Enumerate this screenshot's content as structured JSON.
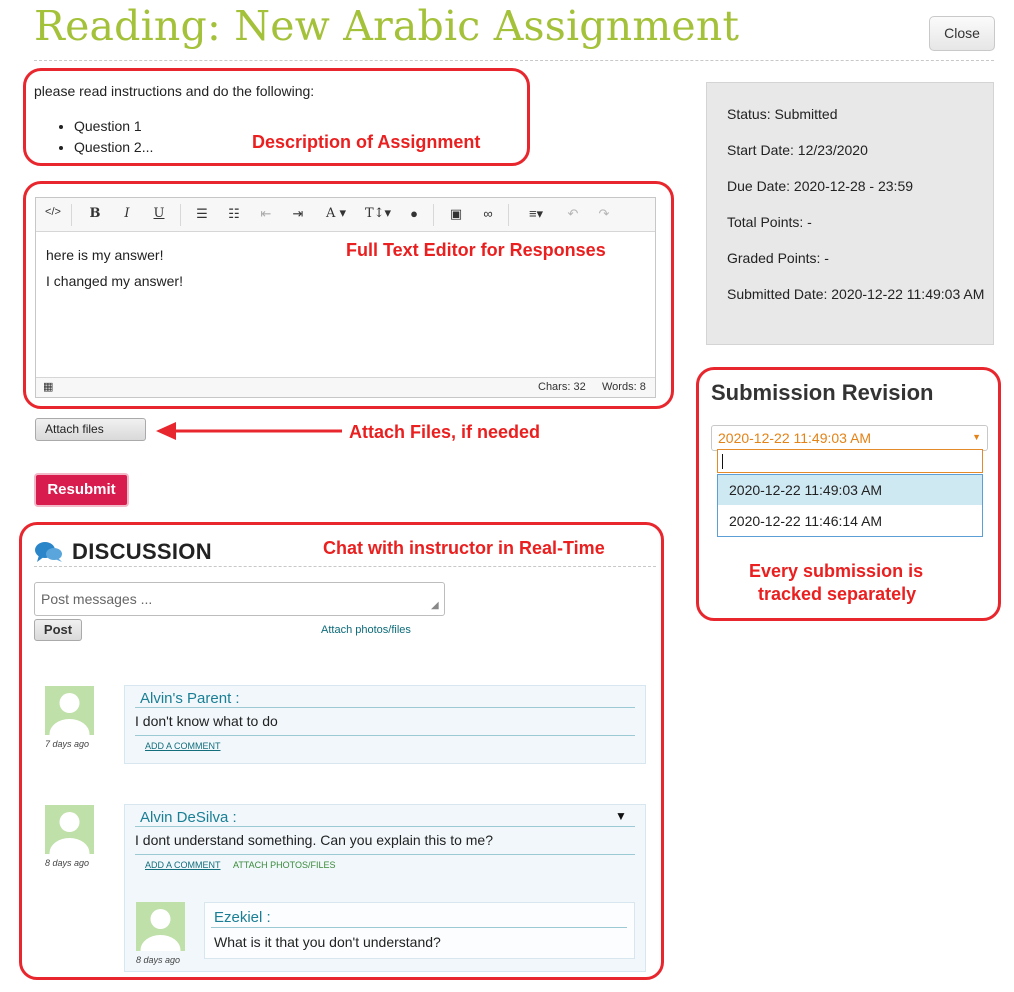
{
  "page": {
    "title": "Reading: New Arabic Assignment",
    "close_label": "Close"
  },
  "description": {
    "intro": "please read instructions and do the following:",
    "items": [
      "Question 1",
      "Question 2..."
    ]
  },
  "editor": {
    "lines": [
      "here is my answer!",
      "I changed my answer!"
    ],
    "chars": "Chars: 32",
    "words": "Words: 8"
  },
  "buttons": {
    "attach_files": "Attach files",
    "resubmit": "Resubmit",
    "post": "Post"
  },
  "callouts": {
    "description": "Description of Assignment",
    "editor": "Full Text Editor for Responses",
    "attach": "Attach Files, if needed",
    "chat": "Chat with instructor in Real-Time",
    "revision_line1": "Every submission is",
    "revision_line2": "tracked separately"
  },
  "discussion": {
    "title": "DISCUSSION",
    "post_placeholder": "Post messages ...",
    "attach_link": "Attach photos/files",
    "messages": [
      {
        "author": "Alvin's Parent :",
        "text": "I don't know what to do",
        "ago": "7 days ago",
        "add_comment": "ADD A COMMENT"
      },
      {
        "author": "Alvin DeSilva :",
        "text": "I dont understand something. Can you explain this to me?",
        "ago": "8 days ago",
        "add_comment": "ADD A COMMENT",
        "attach": "ATTACH PHOTOS/FILES",
        "reply": {
          "author": "Ezekiel :",
          "text": "What is it that you don't understand?",
          "ago": "8 days ago"
        }
      }
    ]
  },
  "status": {
    "status": "Status: Submitted",
    "start_date": "Start Date: 12/23/2020",
    "due_date": "Due Date: 2020-12-28 - 23:59",
    "total_points": "Total Points: -",
    "graded_points": "Graded Points: -",
    "submitted_date": "Submitted Date: 2020-12-22 11:49:03 AM"
  },
  "revision": {
    "title": "Submission Revision",
    "selected": "2020-12-22 11:49:03 AM",
    "options": [
      "2020-12-22 11:49:03 AM",
      "2020-12-22 11:46:14 AM"
    ]
  },
  "colors": {
    "title_green": "#a4c13a",
    "callout_red": "#e8262d",
    "resubmit": "#d81c4e",
    "link_teal": "#1a7f95",
    "select_orange": "#e48216"
  }
}
